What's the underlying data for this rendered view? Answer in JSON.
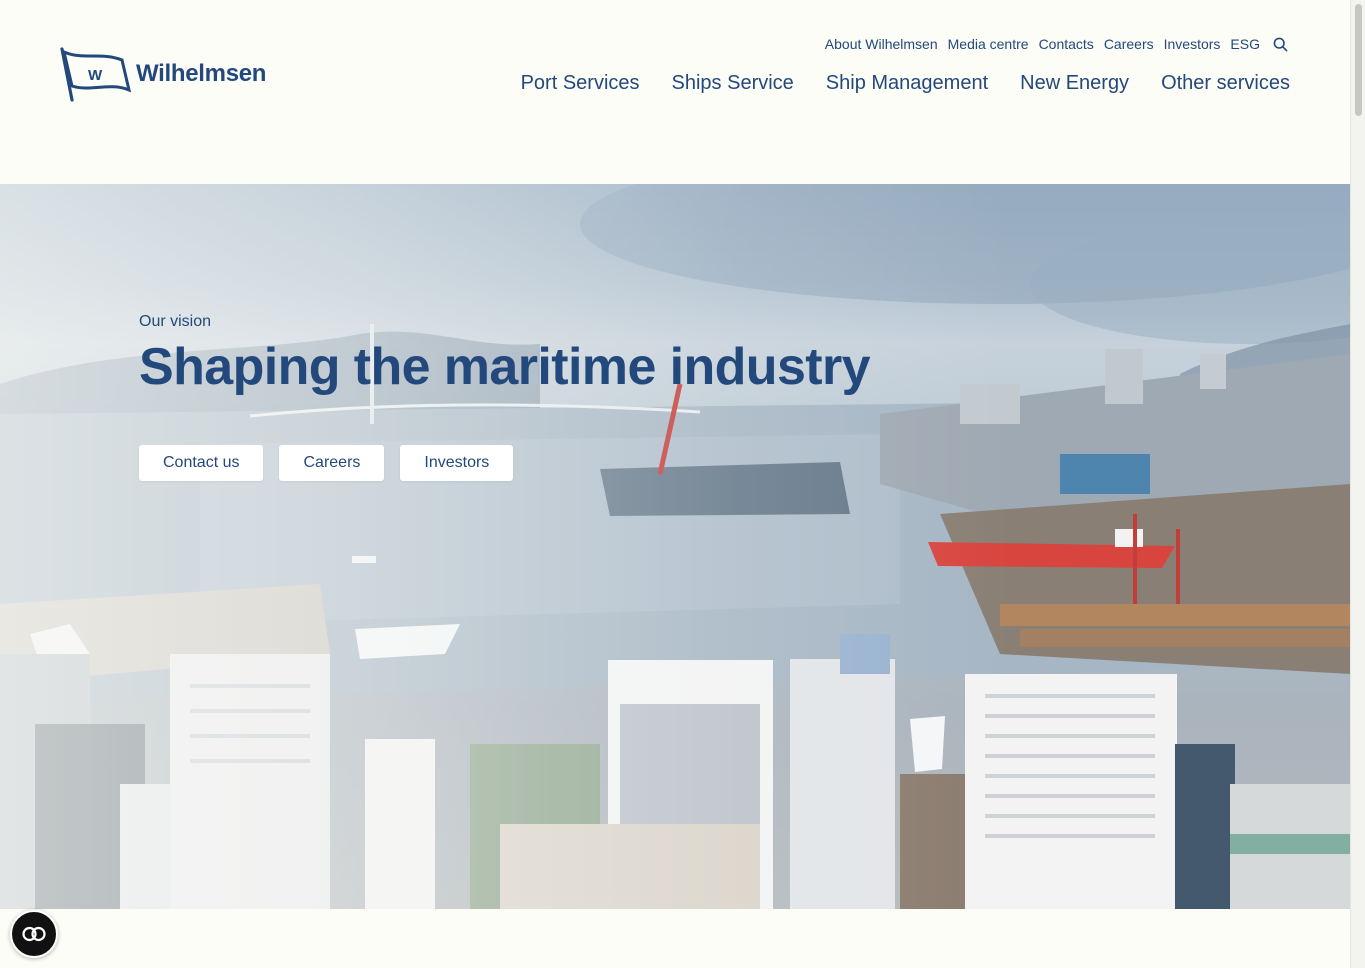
{
  "brand": {
    "name": "Wilhelmsen",
    "flag_letter": "W",
    "color": "#23497c"
  },
  "utility_nav": [
    {
      "label": "About Wilhelmsen"
    },
    {
      "label": "Media centre"
    },
    {
      "label": "Contacts"
    },
    {
      "label": "Careers"
    },
    {
      "label": "Investors"
    },
    {
      "label": "ESG"
    }
  ],
  "main_nav": [
    {
      "label": "Port Services"
    },
    {
      "label": "Ships Service"
    },
    {
      "label": "Ship Management"
    },
    {
      "label": "New Energy"
    },
    {
      "label": "Other services"
    }
  ],
  "hero": {
    "eyebrow": "Our vision",
    "title": "Shaping the maritime industry",
    "buttons": [
      {
        "label": "Contact us"
      },
      {
        "label": "Careers"
      },
      {
        "label": "Investors"
      }
    ],
    "image": "aerial harbour city photo"
  },
  "icons": {
    "search": "search-icon",
    "accessibility": "accessibility-toggle-icon",
    "logo": "flag-logo-icon"
  }
}
